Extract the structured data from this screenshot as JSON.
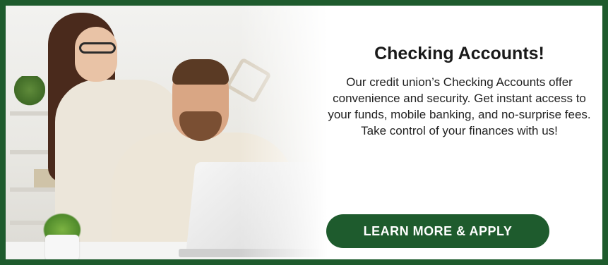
{
  "promo": {
    "title": "Checking Accounts!",
    "description": "Our credit union’s Checking Accounts offer convenience and security. Get instant access to your funds, mobile banking, and no-surprise fees. Take control of your finances with us!",
    "cta_label": "LEARN MORE & APPLY"
  },
  "colors": {
    "brand_green": "#1e5b2d",
    "background": "#ffffff",
    "text": "#222222"
  }
}
